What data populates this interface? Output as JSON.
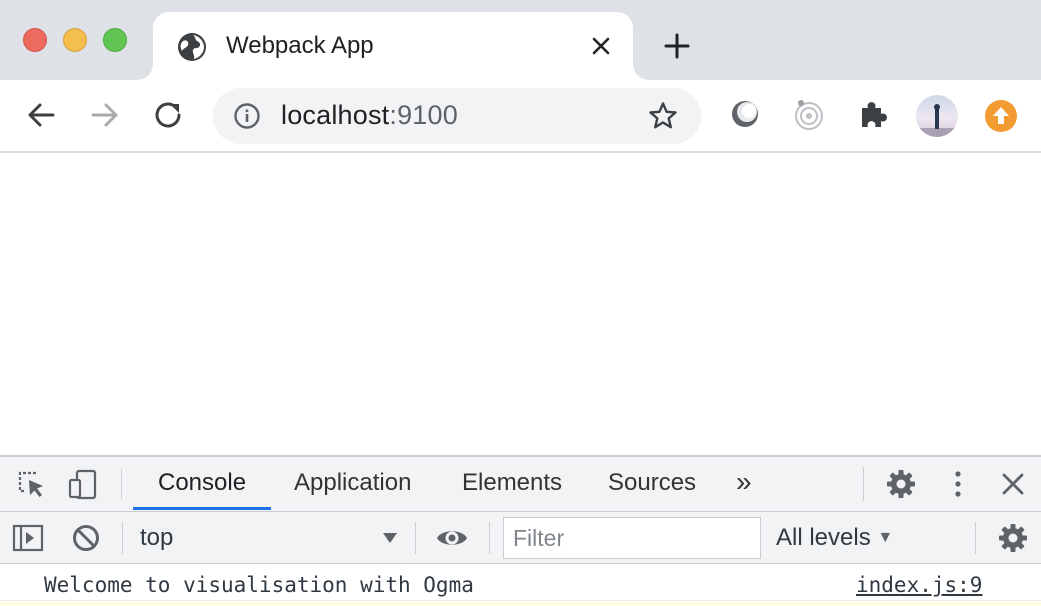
{
  "browser": {
    "tab": {
      "title": "Webpack App",
      "favicon": "globe-icon"
    },
    "address": {
      "host": "localhost",
      "port": ":9100"
    },
    "colors": {
      "tabstrip": "#dee1e6",
      "accent": "#1a73e8",
      "update": "#f29b30"
    }
  },
  "devtools": {
    "tabs": [
      {
        "label": "Console",
        "active": true
      },
      {
        "label": "Application",
        "active": false
      },
      {
        "label": "Elements",
        "active": false
      },
      {
        "label": "Sources",
        "active": false
      }
    ],
    "more_tabs": "»",
    "console_toolbar": {
      "context": "top",
      "filter_placeholder": "Filter",
      "levels": "All levels"
    },
    "messages": [
      {
        "text": "Welcome to visualisation with Ogma",
        "source": "index.js:9"
      }
    ]
  }
}
